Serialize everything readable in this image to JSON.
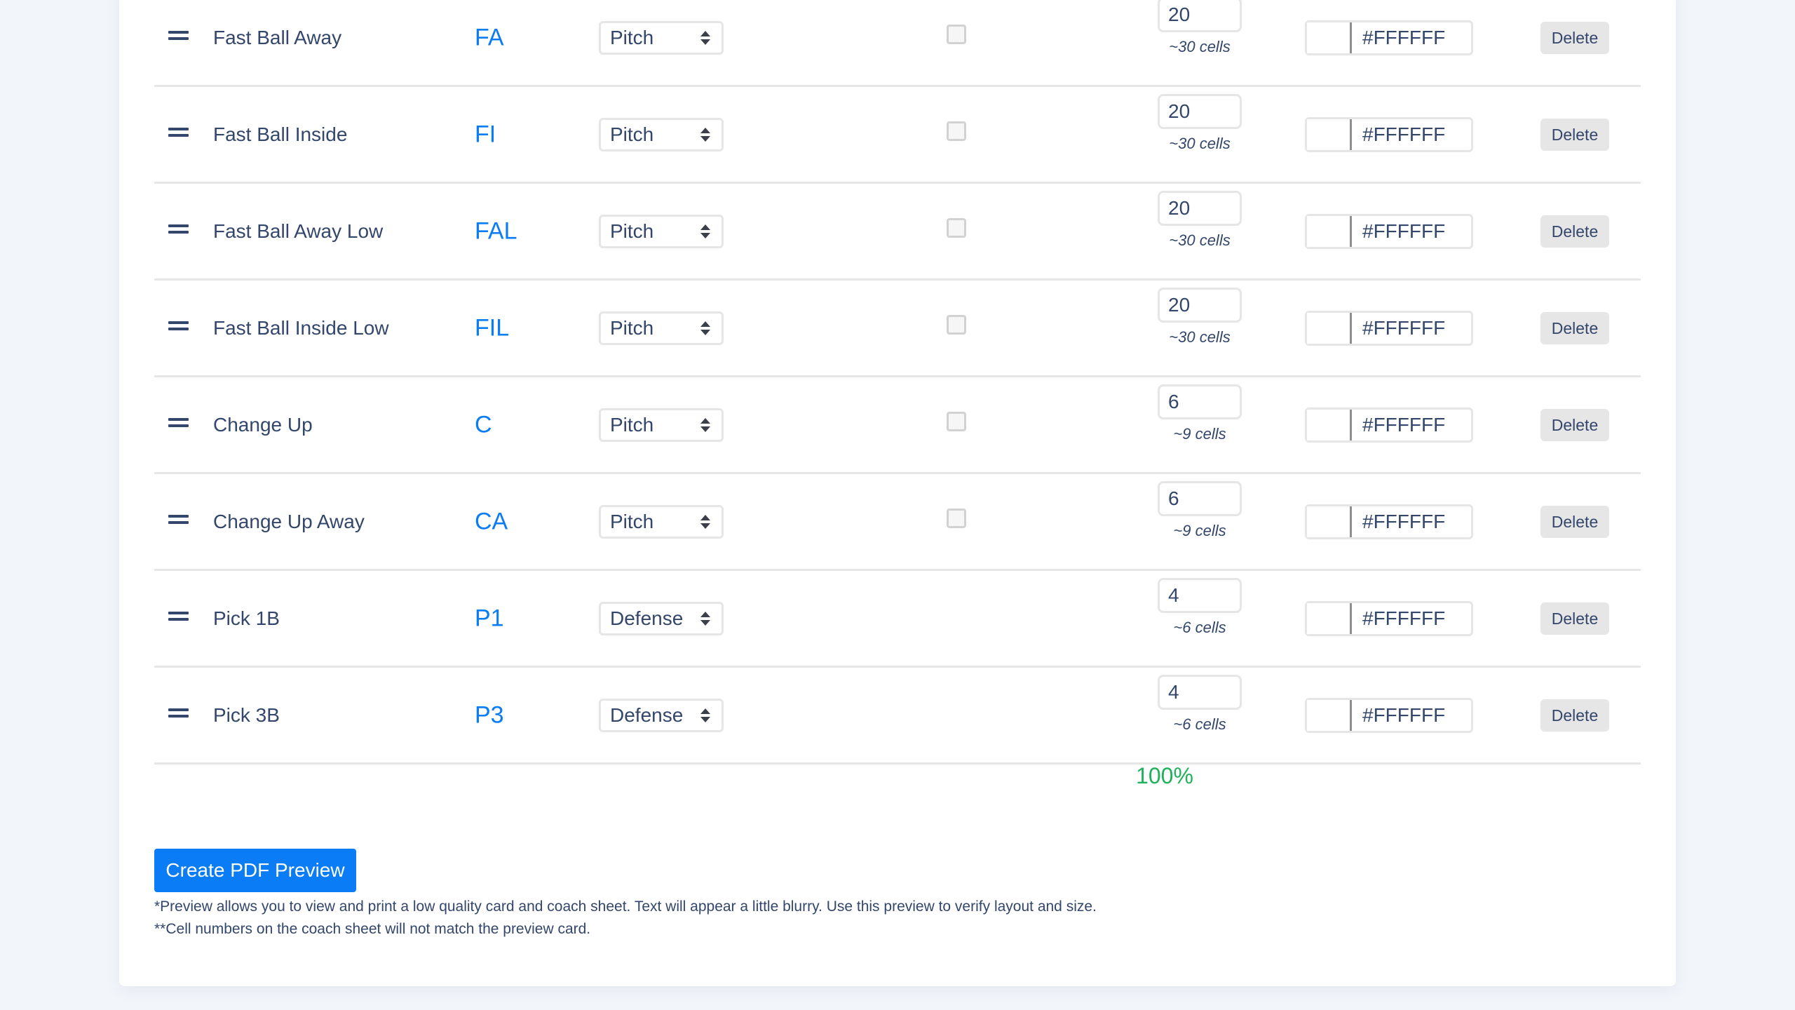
{
  "rows": [
    {
      "name": "Fast Ball Away",
      "abbr": "FA",
      "type": "Pitch",
      "has_checkbox": true,
      "checked": false,
      "count": "20",
      "cells": "~30 cells",
      "color": "#FFFFFF",
      "delete_label": "Delete"
    },
    {
      "name": "Fast Ball Inside",
      "abbr": "FI",
      "type": "Pitch",
      "has_checkbox": true,
      "checked": false,
      "count": "20",
      "cells": "~30 cells",
      "color": "#FFFFFF",
      "delete_label": "Delete"
    },
    {
      "name": "Fast Ball Away Low",
      "abbr": "FAL",
      "type": "Pitch",
      "has_checkbox": true,
      "checked": false,
      "count": "20",
      "cells": "~30 cells",
      "color": "#FFFFFF",
      "delete_label": "Delete"
    },
    {
      "name": "Fast Ball Inside Low",
      "abbr": "FIL",
      "type": "Pitch",
      "has_checkbox": true,
      "checked": false,
      "count": "20",
      "cells": "~30 cells",
      "color": "#FFFFFF",
      "delete_label": "Delete"
    },
    {
      "name": "Change Up",
      "abbr": "C",
      "type": "Pitch",
      "has_checkbox": true,
      "checked": false,
      "count": "6",
      "cells": "~9 cells",
      "color": "#FFFFFF",
      "delete_label": "Delete"
    },
    {
      "name": "Change Up Away",
      "abbr": "CA",
      "type": "Pitch",
      "has_checkbox": true,
      "checked": false,
      "count": "6",
      "cells": "~9 cells",
      "color": "#FFFFFF",
      "delete_label": "Delete"
    },
    {
      "name": "Pick 1B",
      "abbr": "P1",
      "type": "Defense",
      "has_checkbox": false,
      "checked": false,
      "count": "4",
      "cells": "~6 cells",
      "color": "#FFFFFF",
      "delete_label": "Delete"
    },
    {
      "name": "Pick 3B",
      "abbr": "P3",
      "type": "Defense",
      "has_checkbox": false,
      "checked": false,
      "count": "4",
      "cells": "~6 cells",
      "color": "#FFFFFF",
      "delete_label": "Delete"
    }
  ],
  "total_percent": "100%",
  "colors": {
    "accent": "#0A7CF5",
    "success": "#1FB25A",
    "text": "#33466B"
  },
  "footer": {
    "create_pdf_label": "Create PDF Preview",
    "note1": "*Preview allows you to view and print a low quality card and coach sheet. Text will appear a little blurry. Use this preview to verify layout and size.",
    "note2": "**Cell numbers on the coach sheet will not match the preview card."
  },
  "icons": {
    "drag": "drag-handle-icon",
    "select": "select-arrows-icon"
  }
}
